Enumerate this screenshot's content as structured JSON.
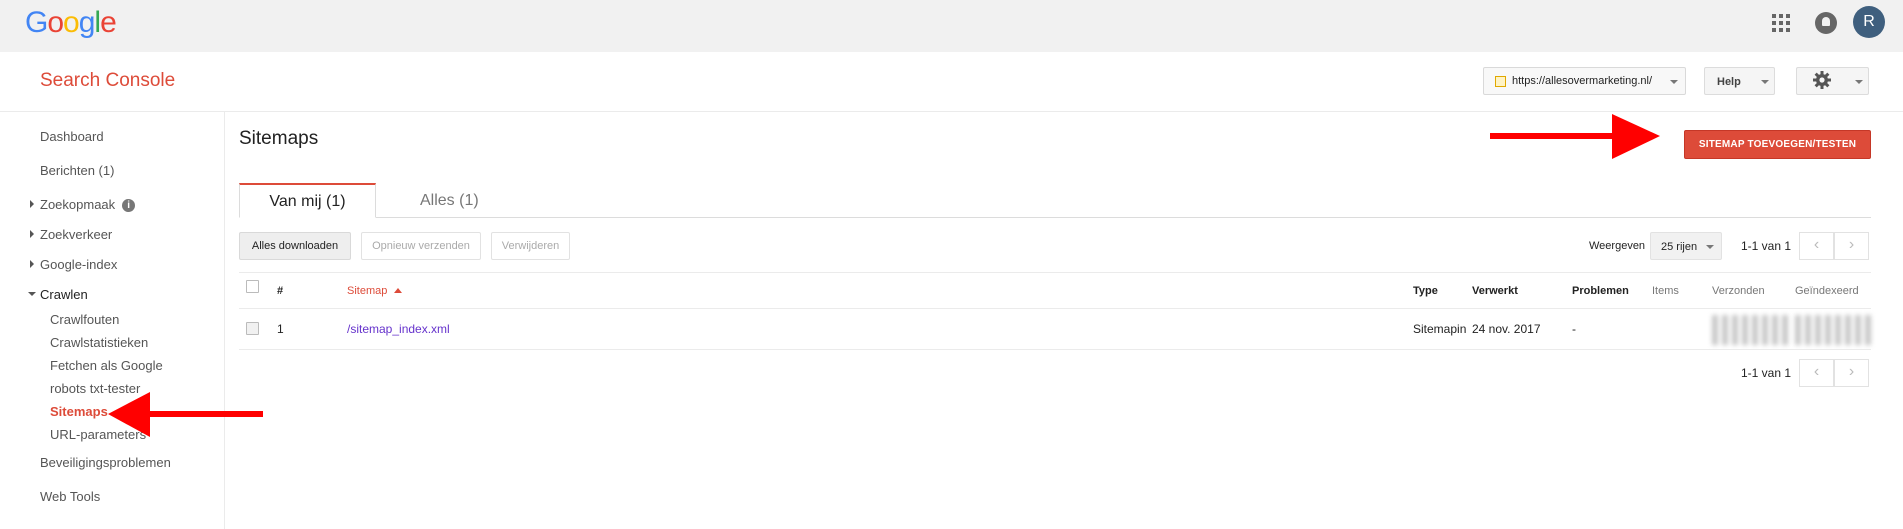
{
  "topbar": {
    "logo_letters": [
      "G",
      "o",
      "o",
      "g",
      "l",
      "e"
    ],
    "logo_colors": [
      "#4285f4",
      "#ea4335",
      "#fbbc05",
      "#4285f4",
      "#34a853",
      "#ea4335"
    ],
    "avatar_initial": "R",
    "icons": [
      "apps-grid-icon",
      "notification-bell-icon"
    ]
  },
  "header": {
    "product_title": "Search Console",
    "site_url": "https://allesovermarketing.nl/",
    "help_label": "Help",
    "settings_icon": "gear-icon"
  },
  "sidebar": {
    "items": [
      {
        "label": "Dashboard"
      },
      {
        "label": "Berichten (1)"
      },
      {
        "label": "Zoekopmaak",
        "info": "i"
      },
      {
        "label": "Zoekverkeer"
      },
      {
        "label": "Google-index"
      },
      {
        "label": "Crawlen"
      },
      {
        "label": "Beveiligingsproblemen"
      },
      {
        "label": "Web Tools"
      }
    ],
    "crawl_sub": [
      {
        "label": "Crawlfouten"
      },
      {
        "label": "Crawlstatistieken"
      },
      {
        "label": "Fetchen als Google"
      },
      {
        "label": "robots txt-tester"
      },
      {
        "label": "Sitemaps",
        "active": true
      },
      {
        "label": "URL-parameters"
      }
    ]
  },
  "main": {
    "title": "Sitemaps",
    "add_button": "SITEMAP TOEVOEGEN/TESTEN",
    "tabs": [
      {
        "label": "Van mij (1)",
        "active": true
      },
      {
        "label": "Alles (1)"
      }
    ],
    "actions": {
      "download": "Alles downloaden",
      "resubmit": "Opnieuw verzenden",
      "delete": "Verwijderen"
    },
    "show_label": "Weergeven",
    "rows_value": "25 rijen",
    "pager_text": "1-1 van 1",
    "table": {
      "headers": {
        "num": "#",
        "sitemap": "Sitemap",
        "type": "Type",
        "processed": "Verwerkt",
        "issues": "Problemen",
        "items": "Items",
        "submitted": "Verzonden",
        "indexed": "Geïndexeerd"
      },
      "rows": [
        {
          "num": "1",
          "sitemap": "/sitemap_index.xml",
          "type": "Sitemapin",
          "processed": "24 nov. 2017",
          "issues": "-"
        }
      ]
    }
  },
  "colors": {
    "accent_red": "#dd4b39",
    "link_purple": "#6633cc",
    "arrow_red": "#ff0000"
  }
}
